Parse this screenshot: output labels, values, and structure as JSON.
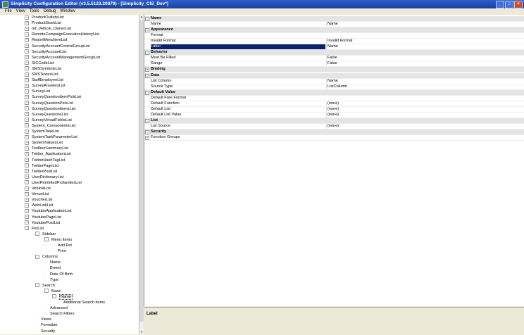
{
  "window": {
    "title": "Simplicity Configuration Editor (v3.5.5123.20879) - [Simplicity_CIS_Dev*]",
    "buttons": {
      "minimize": "_",
      "maximize": "□",
      "close": "×"
    }
  },
  "menu": [
    "File",
    "View",
    "Tools",
    "Debug",
    "Window"
  ],
  "tree": {
    "nodes": [
      {
        "label": "ProductOutletsList",
        "depth": 0,
        "exp": "+"
      },
      {
        "label": "ProductStockList",
        "depth": 0,
        "exp": "+"
      },
      {
        "label": "ref_Vehicle_OwnerList",
        "depth": 0,
        "exp": "+"
      },
      {
        "label": "RemoteCampaignExecutionHistoryList",
        "depth": 0,
        "exp": "+"
      },
      {
        "label": "ReportMenuItemList",
        "depth": 0,
        "exp": "+"
      },
      {
        "label": "SecurityAccountControlGroupList",
        "depth": 0,
        "exp": "+"
      },
      {
        "label": "SecurityAccountList",
        "depth": 0,
        "exp": "+"
      },
      {
        "label": "SecurityAccountManagementGroupList",
        "depth": 0,
        "exp": "+"
      },
      {
        "label": "SICCodeList",
        "depth": 0,
        "exp": "+"
      },
      {
        "label": "SMSSymbolsList",
        "depth": 0,
        "exp": "+"
      },
      {
        "label": "SMSTextesList",
        "depth": 0,
        "exp": "+"
      },
      {
        "label": "StaffEmployeeList",
        "depth": 0,
        "exp": "+"
      },
      {
        "label": "SurveyAnswersList",
        "depth": 0,
        "exp": "+"
      },
      {
        "label": "SurveyList",
        "depth": 0,
        "exp": "+"
      },
      {
        "label": "SurveyQuestionItemPickList",
        "depth": 0,
        "exp": "+"
      },
      {
        "label": "SurveyQuestionPickList",
        "depth": 0,
        "exp": "+"
      },
      {
        "label": "SurveyQuestionItemsList",
        "depth": 0,
        "exp": "+"
      },
      {
        "label": "SurveyQuestionsList",
        "depth": 0,
        "exp": "+"
      },
      {
        "label": "SurveyVirtualFieldsList",
        "depth": 0,
        "exp": "+"
      },
      {
        "label": "System_ComponentsList",
        "depth": 0,
        "exp": "+"
      },
      {
        "label": "SystemTaskList",
        "depth": 0,
        "exp": "+"
      },
      {
        "label": "SystemTaskParameterList",
        "depth": 0,
        "exp": "+"
      },
      {
        "label": "SystemValuesList",
        "depth": 0,
        "exp": "+"
      },
      {
        "label": "ToolboxSummaryList",
        "depth": 0,
        "exp": "+"
      },
      {
        "label": "Twitter_ApplicationList",
        "depth": 0,
        "exp": "+"
      },
      {
        "label": "TwitterHashTagList",
        "depth": 0,
        "exp": "+"
      },
      {
        "label": "TwitterPageList",
        "depth": 0,
        "exp": "+"
      },
      {
        "label": "TwitterPostList",
        "depth": 0,
        "exp": "+"
      },
      {
        "label": "UserDictionaryList",
        "depth": 0,
        "exp": "+"
      },
      {
        "label": "UserPermittedProfanitiesList",
        "depth": 0,
        "exp": "+"
      },
      {
        "label": "VehicleList",
        "depth": 0,
        "exp": "+"
      },
      {
        "label": "VenueList",
        "depth": 0,
        "exp": "+"
      },
      {
        "label": "VoucherList",
        "depth": 0,
        "exp": "+"
      },
      {
        "label": "WebLinkList",
        "depth": 0,
        "exp": "+"
      },
      {
        "label": "YoutubeApplicationList",
        "depth": 0,
        "exp": "+"
      },
      {
        "label": "YoutubePageList",
        "depth": 0,
        "exp": "+"
      },
      {
        "label": "YoutubePostList",
        "depth": 0,
        "exp": "+"
      },
      {
        "label": "PetList",
        "depth": 0,
        "exp": "-"
      },
      {
        "label": "Sidebar",
        "depth": 1,
        "exp": "-"
      },
      {
        "label": "Menu Items",
        "depth": 2,
        "exp": "-"
      },
      {
        "label": "Add Pet",
        "depth": 3,
        "exp": ""
      },
      {
        "label": "Print",
        "depth": 3,
        "exp": ""
      },
      {
        "label": "Columns",
        "depth": 1,
        "exp": "-"
      },
      {
        "label": "Name",
        "depth": 2,
        "exp": ""
      },
      {
        "label": "Breed",
        "depth": 2,
        "exp": ""
      },
      {
        "label": "Date Of Birth",
        "depth": 2,
        "exp": ""
      },
      {
        "label": "Type",
        "depth": 2,
        "exp": ""
      },
      {
        "label": "Search",
        "depth": 1,
        "exp": "-"
      },
      {
        "label": "Basic",
        "depth": 2,
        "exp": "-"
      },
      {
        "label": "Name",
        "depth": 3,
        "exp": "-",
        "selected": true
      },
      {
        "label": "Additional Search Items",
        "depth": 4,
        "exp": ""
      },
      {
        "label": "Advanced",
        "depth": 2,
        "exp": ""
      },
      {
        "label": "Search Filters",
        "depth": 2,
        "exp": ""
      },
      {
        "label": "Views",
        "depth": 1,
        "exp": ""
      },
      {
        "label": "Formulae",
        "depth": 1,
        "exp": ""
      },
      {
        "label": "Security",
        "depth": 1,
        "exp": ""
      }
    ]
  },
  "properties": {
    "rows": [
      {
        "kind": "cat",
        "name": "Name",
        "exp": "-"
      },
      {
        "kind": "prop",
        "name": "Name",
        "value": "Name"
      },
      {
        "kind": "cat",
        "name": "Appearance",
        "exp": "-"
      },
      {
        "kind": "prop",
        "name": "Format",
        "value": ""
      },
      {
        "kind": "prop",
        "name": "Invalid Format",
        "value": "Invalid Format"
      },
      {
        "kind": "prop",
        "name": "Label",
        "value": "Name",
        "selected": true
      },
      {
        "kind": "cat",
        "name": "Behavior",
        "exp": "-"
      },
      {
        "kind": "prop",
        "name": "Must Be Filled",
        "value": "False"
      },
      {
        "kind": "prop",
        "name": "Range",
        "value": "False"
      },
      {
        "kind": "cat",
        "name": "Binding",
        "exp": "+"
      },
      {
        "kind": "cat",
        "name": "Data",
        "exp": "-"
      },
      {
        "kind": "prop",
        "name": "List Column",
        "value": "Name"
      },
      {
        "kind": "prop",
        "name": "Source Type",
        "value": "ListColumn"
      },
      {
        "kind": "cat",
        "name": "Default Value",
        "exp": "-"
      },
      {
        "kind": "prop",
        "name": "Default Free Format",
        "value": ""
      },
      {
        "kind": "prop",
        "name": "Default Function",
        "value": "(none)"
      },
      {
        "kind": "prop",
        "name": "Default List",
        "value": "(none)"
      },
      {
        "kind": "prop",
        "name": "Default List Value",
        "value": "(none)"
      },
      {
        "kind": "cat",
        "name": "List",
        "exp": "-"
      },
      {
        "kind": "prop",
        "name": "List Source",
        "value": "(none)"
      },
      {
        "kind": "cat",
        "name": "Security",
        "exp": "-"
      },
      {
        "kind": "propexp",
        "name": "Function Groups",
        "value": "",
        "exp": "+"
      }
    ]
  },
  "description": {
    "title": "Label"
  }
}
